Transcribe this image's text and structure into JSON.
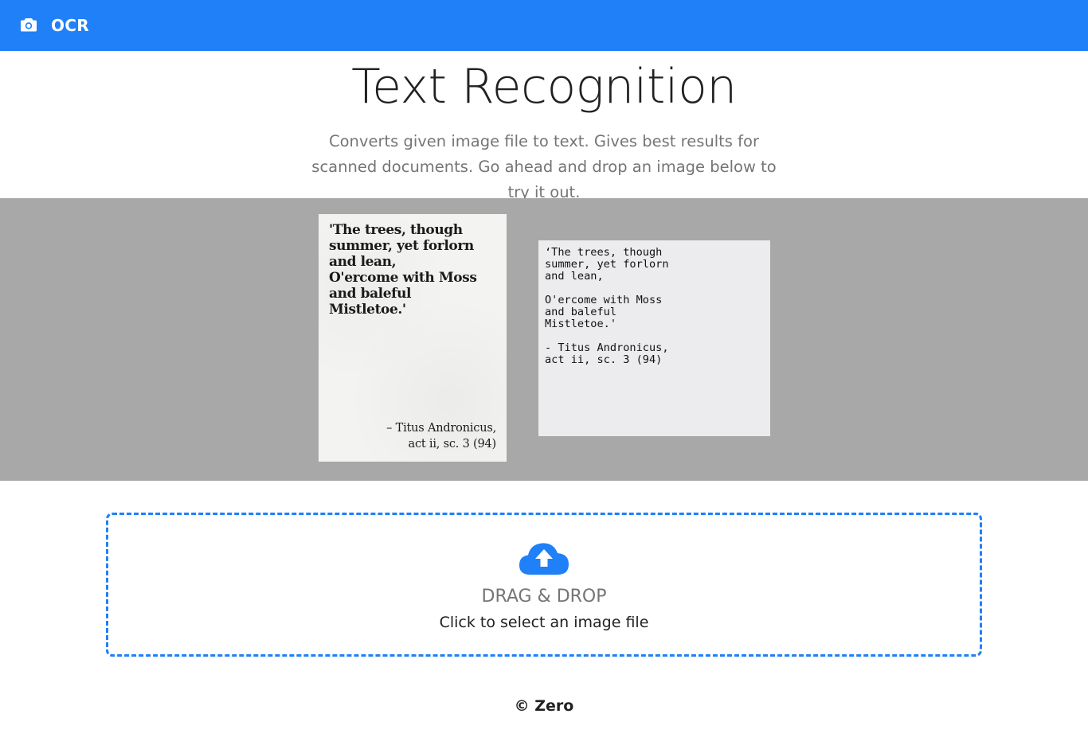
{
  "appbar": {
    "icon": "camera-icon",
    "brand": "OCR",
    "color": "#1f80f7"
  },
  "header": {
    "title": "Text Recognition",
    "subtitle": "Converts given image file to text. Gives best results for scanned documents. Go ahead and drop an image below to try it out."
  },
  "demo": {
    "sample_quote": "'The trees, though\nsummer, yet forlorn\nand lean,\nO'ercome with Moss\nand baleful\nMistletoe.'",
    "sample_attribution": "– Titus Andronicus,\nact ii, sc. 3 (94)",
    "result_text": "‘The trees, though\nsummer, yet forlorn\nand lean,\n\nO'ercome with Moss\nand baleful\nMistletoe.'\n\n- Titus Andronicus,\nact ii, sc. 3 (94)"
  },
  "dropzone": {
    "icon": "cloud-upload-icon",
    "heading": "DRAG & DROP",
    "instruction": "Click to select an image file"
  },
  "footer": {
    "text": "© Zero"
  }
}
